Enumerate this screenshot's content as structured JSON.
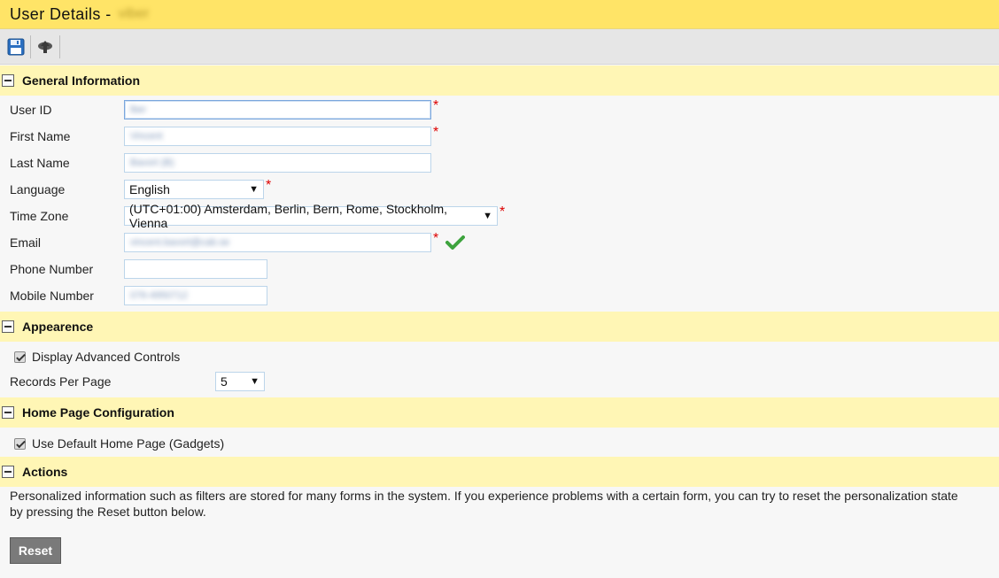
{
  "header": {
    "title": "User Details -",
    "user_name": "viber"
  },
  "toolbar": {
    "save_icon": "save-icon",
    "upload_icon": "upload-icon"
  },
  "sections": {
    "general": {
      "title": "General Information",
      "user_id": {
        "label": "User ID",
        "value": "lber"
      },
      "first_name": {
        "label": "First Name",
        "value": "Vincent"
      },
      "last_name": {
        "label": "Last Name",
        "value": "Bavort (B)"
      },
      "language": {
        "label": "Language",
        "value": "English"
      },
      "time_zone": {
        "label": "Time Zone",
        "value": "(UTC+01:00) Amsterdam, Berlin, Bern, Rome, Stockholm, Vienna"
      },
      "email": {
        "label": "Email",
        "value": "vincent.bavort@cab.se"
      },
      "phone": {
        "label": "Phone Number",
        "value": ""
      },
      "mobile": {
        "label": "Mobile Number",
        "value": "076-4950712"
      }
    },
    "appearance": {
      "title": "Appearence",
      "advanced_controls": "Display Advanced Controls",
      "records_label": "Records Per Page",
      "records_value": "5"
    },
    "home": {
      "title": "Home Page Configuration",
      "default_home": "Use Default Home Page (Gadgets)"
    },
    "actions": {
      "title": "Actions",
      "description": "Personalized information such as filters are stored for many forms in the system. If you experience problems with a certain form, you can try to reset the personalization state by pressing the Reset button below.",
      "reset_label": "Reset"
    }
  },
  "colors": {
    "title_bg": "#ffe467",
    "section_bg": "#fff6b5",
    "required": "#dd0000",
    "valid": "#3da33d"
  }
}
